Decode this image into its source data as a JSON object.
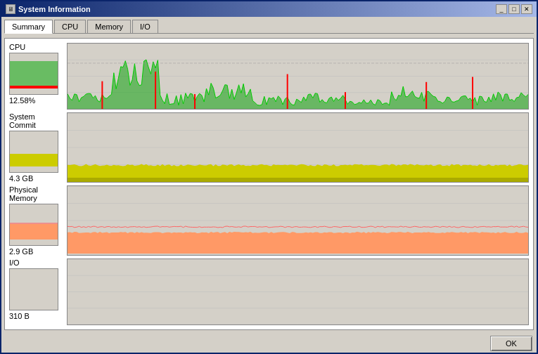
{
  "window": {
    "title": "System Information",
    "title_icon": "ℹ",
    "buttons": {
      "minimize": "_",
      "maximize": "□",
      "close": "✕"
    }
  },
  "tabs": [
    {
      "id": "summary",
      "label": "Summary",
      "active": true
    },
    {
      "id": "cpu",
      "label": "CPU",
      "active": false
    },
    {
      "id": "memory",
      "label": "Memory",
      "active": false
    },
    {
      "id": "io",
      "label": "I/O",
      "active": false
    }
  ],
  "sections": {
    "cpu": {
      "label": "CPU",
      "value": "12.58%"
    },
    "system_commit": {
      "label": "System Commit",
      "value": "4.3 GB"
    },
    "physical_memory": {
      "label": "Physical Memory",
      "value": "2.9 GB"
    },
    "io": {
      "label": "I/O",
      "value": "310 B"
    }
  },
  "buttons": {
    "ok": "OK"
  }
}
